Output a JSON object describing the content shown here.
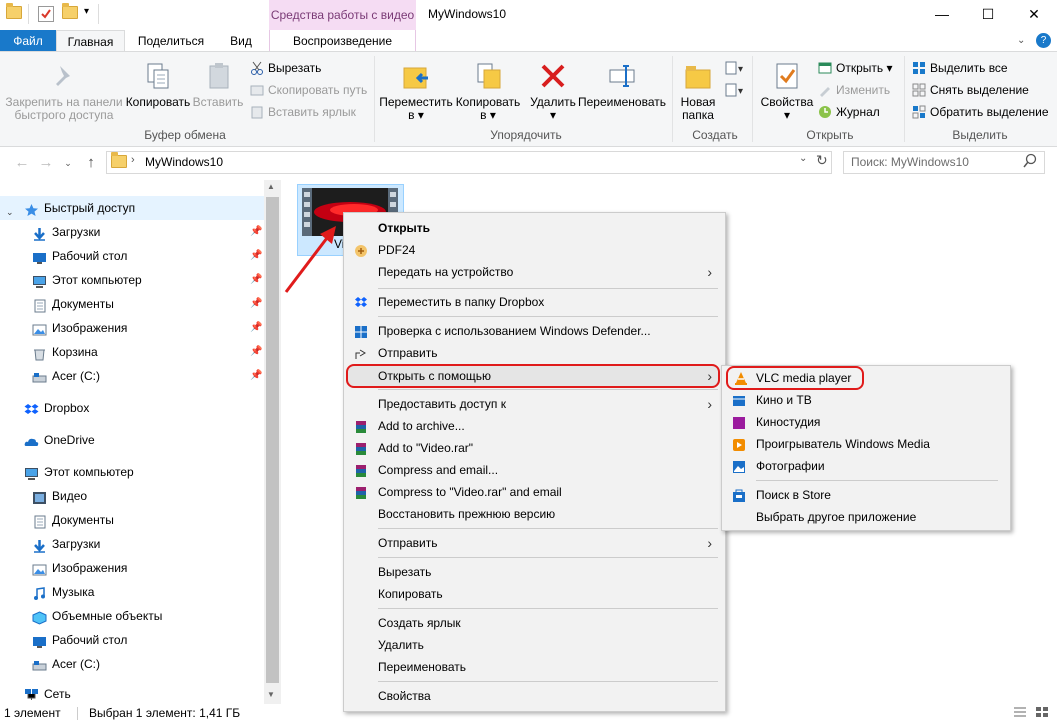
{
  "window": {
    "title": "MyWindows10",
    "context_tab_header": "Средства работы с видео",
    "min_glyph": "—",
    "max_glyph": "☐",
    "close_glyph": "✕"
  },
  "ribbon_tabs": {
    "file": "Файл",
    "home": "Главная",
    "share": "Поделиться",
    "view": "Вид",
    "playback": "Воспроизведение"
  },
  "ribbon": {
    "clipboard": {
      "pin": "Закрепить на панели быстрого доступа",
      "pin_line1": "Закрепить на панели",
      "pin_line2": "быстрого доступа",
      "copy": "Копировать",
      "paste": "Вставить",
      "cut": "Вырезать",
      "copy_path": "Скопировать путь",
      "paste_shortcut": "Вставить ярлык",
      "group_label": "Буфер обмена"
    },
    "organize": {
      "move_to_l1": "Переместить",
      "move_to_l2": "в ▾",
      "copy_to_l1": "Копировать",
      "copy_to_l2": "в ▾",
      "delete": "Удалить",
      "delete_arrow": "▾",
      "rename": "Переименовать",
      "group_label": "Упорядочить"
    },
    "new": {
      "new_folder_l1": "Новая",
      "new_folder_l2": "папка",
      "group_label": "Создать"
    },
    "open": {
      "properties": "Свойства",
      "properties_arrow": "▾",
      "open": "Открыть ▾",
      "edit": "Изменить",
      "history": "Журнал",
      "group_label": "Открыть"
    },
    "select": {
      "select_all": "Выделить все",
      "select_none": "Снять выделение",
      "invert": "Обратить выделение",
      "group_label": "Выделить"
    }
  },
  "address": {
    "path_item": "MyWindows10",
    "search_placeholder": "Поиск: MyWindows10"
  },
  "nav": {
    "quick_access": "Быстрый доступ",
    "items": [
      {
        "label": "Загрузки",
        "icon": "download-icon",
        "pinned": true
      },
      {
        "label": "Рабочий стол",
        "icon": "desktop-icon",
        "pinned": true
      },
      {
        "label": "Этот компьютер",
        "icon": "computer-icon",
        "pinned": true
      },
      {
        "label": "Документы",
        "icon": "documents-icon",
        "pinned": true
      },
      {
        "label": "Изображения",
        "icon": "pictures-icon",
        "pinned": true
      },
      {
        "label": "Корзина",
        "icon": "recycle-bin-icon",
        "pinned": true
      },
      {
        "label": "Acer (C:)",
        "icon": "drive-icon",
        "pinned": true
      }
    ],
    "dropbox": "Dropbox",
    "onedrive": "OneDrive",
    "this_pc": "Этот компьютер",
    "pc_items": [
      {
        "label": "Видео",
        "icon": "video-icon"
      },
      {
        "label": "Документы",
        "icon": "documents-icon"
      },
      {
        "label": "Загрузки",
        "icon": "download-icon"
      },
      {
        "label": "Изображения",
        "icon": "pictures-icon"
      },
      {
        "label": "Музыка",
        "icon": "music-icon"
      },
      {
        "label": "Объемные объекты",
        "icon": "3d-objects-icon"
      },
      {
        "label": "Рабочий стол",
        "icon": "desktop-icon"
      },
      {
        "label": "Acer (C:)",
        "icon": "drive-icon"
      }
    ],
    "network": "Сеть"
  },
  "file": {
    "name_visible": "Vi"
  },
  "context_menu": {
    "items": [
      {
        "label": "Открыть",
        "bold": true
      },
      {
        "label": "PDF24",
        "icon": "pdf24-icon"
      },
      {
        "label": "Передать на устройство",
        "submenu": true
      },
      {
        "label": "Переместить в папку Dropbox",
        "icon": "dropbox-icon"
      },
      {
        "label": "Проверка с использованием Windows Defender...",
        "icon": "defender-icon"
      },
      {
        "label": "Отправить",
        "icon": "share-icon"
      },
      {
        "label": "Открыть с помощью",
        "submenu": true
      },
      {
        "label": "Предоставить доступ к",
        "submenu": true
      },
      {
        "label": "Add to archive...",
        "icon": "winrar-icon"
      },
      {
        "label": "Add to \"Video.rar\"",
        "icon": "winrar-icon"
      },
      {
        "label": "Compress and email...",
        "icon": "winrar-icon"
      },
      {
        "label": "Compress to \"Video.rar\" and email",
        "icon": "winrar-icon"
      },
      {
        "label": "Восстановить прежнюю версию"
      },
      {
        "label": "Отправить",
        "submenu": true
      },
      {
        "label": "Вырезать"
      },
      {
        "label": "Копировать"
      },
      {
        "label": "Создать ярлык"
      },
      {
        "label": "Удалить"
      },
      {
        "label": "Переименовать"
      },
      {
        "label": "Свойства"
      }
    ]
  },
  "open_with_submenu": {
    "items": [
      {
        "label": "VLC media player",
        "icon": "vlc-icon"
      },
      {
        "label": "Кино и ТВ",
        "icon": "movies-tv-icon"
      },
      {
        "label": "Киностудия",
        "icon": "movie-maker-icon"
      },
      {
        "label": "Проигрыватель Windows Media",
        "icon": "windows-media-player-icon"
      },
      {
        "label": "Фотографии",
        "icon": "photos-icon"
      },
      {
        "label": "Поиск в Store",
        "icon": "store-icon"
      },
      {
        "label": "Выбрать другое приложение"
      }
    ]
  },
  "status": {
    "count": "1 элемент",
    "selection": "Выбран 1 элемент: 1,41 ГБ"
  },
  "colors": {
    "accent": "#1979ca",
    "highlight_outline": "#e01b1b",
    "context_tab": "#f5dcf3"
  }
}
